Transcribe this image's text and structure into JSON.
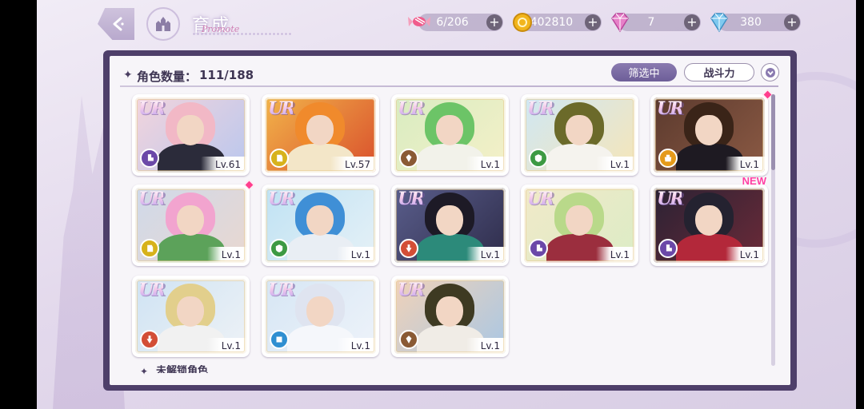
{
  "header": {
    "title": "育成",
    "subtitle": "Promote"
  },
  "resources": [
    {
      "name": "candy",
      "value": "6/206",
      "icon": "candy-icon"
    },
    {
      "name": "coin",
      "value": "402810",
      "icon": "coin-icon"
    },
    {
      "name": "pink-diamond",
      "value": "7",
      "icon": "pink-diamond-icon"
    },
    {
      "name": "blue-diamond",
      "value": "380",
      "icon": "blue-diamond-icon"
    }
  ],
  "plus_label": "+",
  "panel": {
    "count_label": "角色数量：",
    "count_value": "111/188",
    "filter_label": "筛选中",
    "sort_label": "战斗力",
    "locked_label": "未解锁角色"
  },
  "cards": [
    {
      "rarity": "UR",
      "level": "Lv.61",
      "attr": "purple",
      "bg": [
        "#f3d4dc",
        "#b9c7ee"
      ],
      "hair": "#f2b8c6",
      "outfit": "#2b2b3a",
      "new": "",
      "dot": false
    },
    {
      "rarity": "UR",
      "level": "Lv.57",
      "attr": "yellow",
      "bg": [
        "#f2b44a",
        "#d94f2c"
      ],
      "hair": "#f08a2c",
      "outfit": "#f3e6c8",
      "new": "",
      "dot": false
    },
    {
      "rarity": "UR",
      "level": "Lv.1",
      "attr": "brown",
      "bg": [
        "#d8ecc1",
        "#f5f0c8"
      ],
      "hair": "#6cc467",
      "outfit": "#f2f2ea",
      "new": "",
      "dot": false
    },
    {
      "rarity": "UR",
      "level": "Lv.1",
      "attr": "green",
      "bg": [
        "#cfe7f4",
        "#f6e6b8"
      ],
      "hair": "#6b6a2a",
      "outfit": "#f5f3ee",
      "new": "",
      "dot": false
    },
    {
      "rarity": "UR",
      "level": "Lv.1",
      "attr": "orange",
      "bg": [
        "#5b3a2e",
        "#8c5a44"
      ],
      "hair": "#3a2418",
      "outfit": "#1e1a22",
      "new": "",
      "dot": true
    },
    {
      "rarity": "UR",
      "level": "Lv.1",
      "attr": "yellow",
      "bg": [
        "#cfd9ea",
        "#e9d8d0"
      ],
      "hair": "#f2a4cf",
      "outfit": "#5ca25a",
      "new": "",
      "dot": true
    },
    {
      "rarity": "UR",
      "level": "Lv.1",
      "attr": "green",
      "bg": [
        "#bfe2f3",
        "#e6f1f7"
      ],
      "hair": "#3f8fd6",
      "outfit": "#e9eef4",
      "new": "",
      "dot": false
    },
    {
      "rarity": "UR",
      "level": "Lv.1",
      "attr": "red",
      "bg": [
        "#5a5e8c",
        "#2e2c4a"
      ],
      "hair": "#1d1a26",
      "outfit": "#2c8a7a",
      "new": "",
      "dot": false
    },
    {
      "rarity": "UR",
      "level": "Lv.1",
      "attr": "purple",
      "bg": [
        "#f1e9c8",
        "#dcecc6"
      ],
      "hair": "#b9d98a",
      "outfit": "#9b2e3e",
      "new": "",
      "dot": false
    },
    {
      "rarity": "UR",
      "level": "Lv.1",
      "attr": "purple",
      "bg": [
        "#2a2234",
        "#6c2a38"
      ],
      "hair": "#242230",
      "outfit": "#b3283a",
      "new": "NEW",
      "dot": false
    },
    {
      "rarity": "UR",
      "level": "Lv.1",
      "attr": "red",
      "bg": [
        "#cfe3f3",
        "#eef2f6"
      ],
      "hair": "#e2cf8c",
      "outfit": "#f1f1f1",
      "new": "",
      "dot": false
    },
    {
      "rarity": "UR",
      "level": "Lv.1",
      "attr": "blue",
      "bg": [
        "#d6e6f4",
        "#eef3fa"
      ],
      "hair": "#dfe4f0",
      "outfit": "#f5f7fb",
      "new": "",
      "dot": false
    },
    {
      "rarity": "UR",
      "level": "Lv.1",
      "attr": "brown",
      "bg": [
        "#f1d2b8",
        "#a9c7e4"
      ],
      "hair": "#3e3a22",
      "outfit": "#f0ece6",
      "new": "",
      "dot": false
    }
  ]
}
